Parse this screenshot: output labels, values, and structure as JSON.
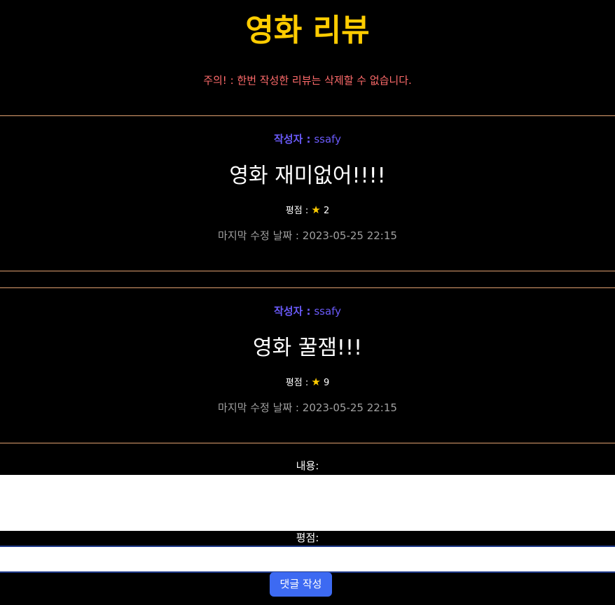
{
  "header": {
    "title": "영화 리뷰",
    "warning": "주의! : 한번 작성한 리뷰는 삭제할 수 없습니다."
  },
  "reviews": [
    {
      "author_label": "작성자 :",
      "author": "ssafy",
      "title": "영화 재미없어!!!!",
      "rating_label": "평점 :",
      "star_icon": "★",
      "rating": "2",
      "modified_label": "마지막 수정 날짜 :",
      "modified": "2023-05-25 22:15"
    },
    {
      "author_label": "작성자 :",
      "author": "ssafy",
      "title": "영화 꿀잼!!!",
      "rating_label": "평점 :",
      "star_icon": "★",
      "rating": "9",
      "modified_label": "마지막 수정 날짜 :",
      "modified": "2023-05-25 22:15"
    }
  ],
  "form": {
    "content_label": "내용:",
    "content_value": "",
    "rating_label": "평점:",
    "rating_value": "",
    "submit_label": "댓글 작성"
  },
  "colors": {
    "background": "#000000",
    "title": "#ffcc00",
    "warning": "#ff6b6b",
    "author": "#6a5af9",
    "divider": "#e0a070",
    "button": "#3d6af2"
  }
}
